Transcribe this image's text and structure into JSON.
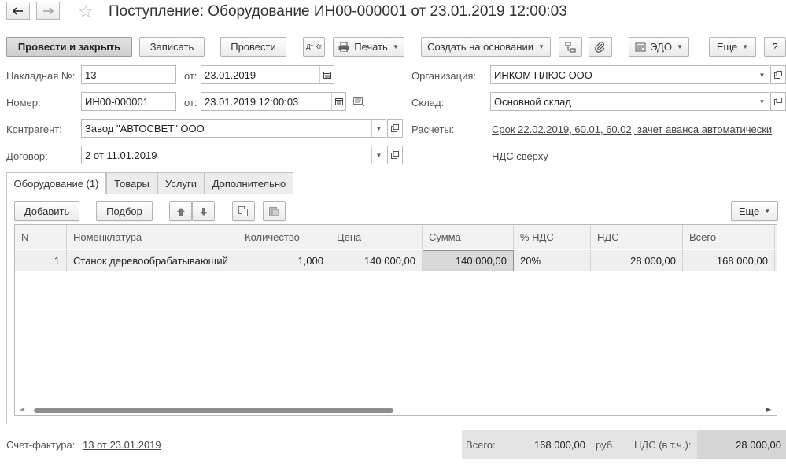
{
  "window": {
    "title": "Поступление: Оборудование ИН00-000001 от 23.01.2019 12:00:03",
    "nav_back_icon": "arrow-left-icon",
    "nav_forward_icon": "arrow-right-icon",
    "favorite_icon": "star-icon"
  },
  "toolbar": {
    "post_close_label": "Провести и закрыть",
    "save_label": "Записать",
    "post_label": "Провести",
    "dt_kt_label": "Дт Кт",
    "print_label": "Печать",
    "create_based_label": "Создать на основании",
    "edo_label": "ЭДО",
    "more_label": "Еще",
    "help_label": "?"
  },
  "form": {
    "invoice_label": "Накладная №:",
    "invoice_number": "13",
    "from_label_1": "от:",
    "invoice_date": "23.01.2019",
    "number_label": "Номер:",
    "number_value": "ИН00-000001",
    "from_label_2": "от:",
    "number_datetime": "23.01.2019 12:00:03",
    "counterparty_label": "Контрагент:",
    "counterparty_value": "Завод \"АВТОСВЕТ\" ООО",
    "contract_label": "Договор:",
    "contract_value": "2 от 11.01.2019",
    "organization_label": "Организация:",
    "organization_value": "ИНКОМ ПЛЮС ООО",
    "warehouse_label": "Склад:",
    "warehouse_value": "Основной склад",
    "settlements_label": "Расчеты:",
    "settlements_link": "Срок 22.02.2019, 60.01, 60.02, зачет аванса автоматически",
    "vat_link": "НДС сверху"
  },
  "tabs": [
    {
      "label": "Оборудование (1)",
      "active": true
    },
    {
      "label": "Товары",
      "active": false
    },
    {
      "label": "Услуги",
      "active": false
    },
    {
      "label": "Дополнительно",
      "active": false
    }
  ],
  "table_toolbar": {
    "add_label": "Добавить",
    "pick_label": "Подбор",
    "more_label": "Еще"
  },
  "table": {
    "columns": [
      "N",
      "Номенклатура",
      "Количество",
      "Цена",
      "Сумма",
      "% НДС",
      "НДС",
      "Всего"
    ],
    "rows": [
      [
        "1",
        "Станок деревообрабатывающий",
        "1,000",
        "140 000,00",
        "140 000,00",
        "20%",
        "28 000,00",
        "168 000,00"
      ]
    ]
  },
  "footer": {
    "invoice_label": "Счет-фактура:",
    "invoice_link": "13 от 23.01.2019",
    "total_label": "Всего:",
    "total_value": "168 000,00",
    "currency": "руб.",
    "vat_label": "НДС (в т.ч.):",
    "vat_value": "28 000,00"
  }
}
